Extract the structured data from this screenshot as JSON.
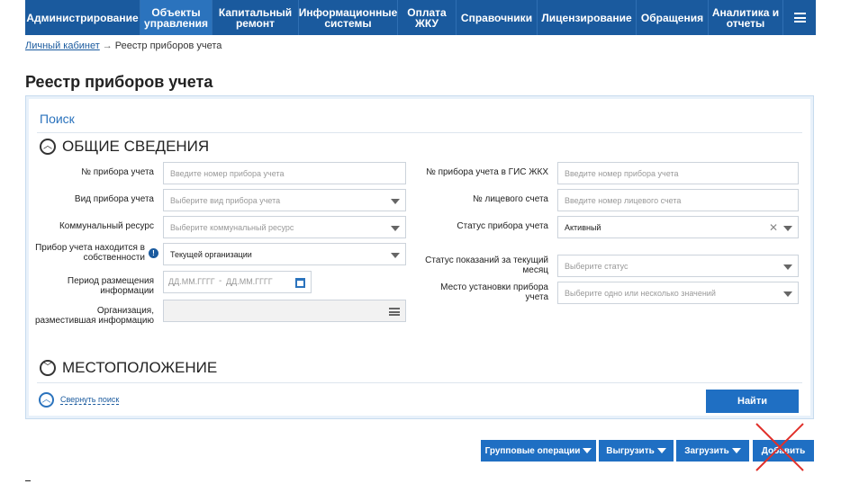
{
  "nav": {
    "items": [
      {
        "label": "Администрирование"
      },
      {
        "label": "Объекты\nуправления"
      },
      {
        "label": "Капитальный\nремонт"
      },
      {
        "label": "Информационные\nсистемы"
      },
      {
        "label": "Оплата\nЖКУ"
      },
      {
        "label": "Справочники"
      },
      {
        "label": "Лицензирование"
      },
      {
        "label": "Обращения"
      },
      {
        "label": "Аналитика и\nотчеты"
      }
    ],
    "menu_icon": "hamburger-icon"
  },
  "breadcrumb": {
    "home": "Личный кабинет",
    "arrow": "→",
    "current": "Реестр приборов учета"
  },
  "page": {
    "title": "Реестр приборов учета"
  },
  "search": {
    "title": "Поиск",
    "general_section": "ОБЩИЕ СВЕДЕНИЯ",
    "location_section": "МЕСТОПОЛОЖЕНИЕ",
    "collapse_label": "Свернуть поиск",
    "find_button": "Найти",
    "left_fields": {
      "device_number": {
        "label": "№ прибора учета",
        "placeholder": "Введите номер прибора учета"
      },
      "device_type": {
        "label": "Вид прибора учета",
        "placeholder": "Выберите вид прибора учета"
      },
      "resource": {
        "label": "Коммунальный ресурс",
        "placeholder": "Выберите коммунальный ресурс"
      },
      "ownership": {
        "label": "Прибор учета находится в собственности",
        "value": "Текущей организации"
      },
      "period": {
        "label": "Период размещения информации",
        "from_placeholder": "ДД.ММ.ГГГГ",
        "separator": "-",
        "to_placeholder": "ДД.ММ.ГГГГ"
      },
      "organization": {
        "label": "Организация, разместившая информацию",
        "value": ""
      }
    },
    "right_fields": {
      "gis_number": {
        "label": "№ прибора учета в ГИС ЖКХ",
        "placeholder": "Введите номер прибора учета"
      },
      "account_number": {
        "label": "№ лицевого счета",
        "placeholder": "Введите номер лицевого счета"
      },
      "device_status": {
        "label": "Статус прибора учета",
        "value": "Активный"
      },
      "readings_status": {
        "label": "Статус показаний за текущий месяц",
        "placeholder": "Выберите статус"
      },
      "install_place": {
        "label": "Место установки прибора учета",
        "placeholder": "Выберите одно или несколько значений"
      }
    }
  },
  "actions": {
    "group_ops": "Групповые операции",
    "export": "Выгрузить",
    "import": "Загрузить",
    "add": "Добавить"
  },
  "colors": {
    "nav_bg": "#1a5a9e",
    "accent": "#2b73bd",
    "button": "#1f6fc3",
    "cross_mark": "#e0302a"
  }
}
